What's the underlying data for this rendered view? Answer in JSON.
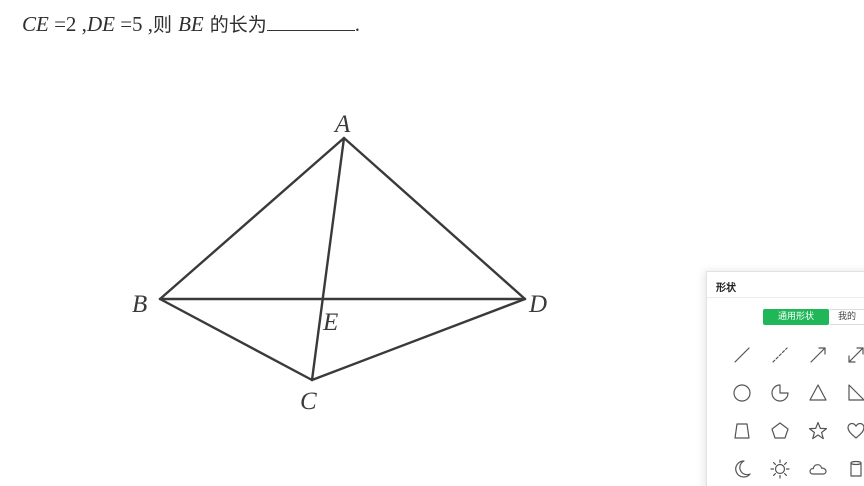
{
  "question": {
    "seg1": "CE",
    "seg2": " =2 ,",
    "seg3": "DE",
    "seg4": " =5 ,",
    "seg5": "则 ",
    "seg6": "BE",
    "seg7": " 的长为",
    "seg8": "."
  },
  "figure": {
    "labels": {
      "A": "A",
      "B": "B",
      "C": "C",
      "D": "D",
      "E": "E"
    },
    "colors": {
      "line": "#3a3a3a"
    }
  },
  "shape_panel": {
    "title": "形状",
    "tabs": [
      {
        "label": "通用形状",
        "active": true
      },
      {
        "label": "我的",
        "active": false
      }
    ],
    "shapes": [
      "line-icon",
      "dashed-line-icon",
      "arrow-icon",
      "double-arrow-icon",
      "circle-icon",
      "pie-icon",
      "triangle-icon",
      "right-triangle-icon",
      "trapezoid-icon",
      "pentagon-icon",
      "star-icon",
      "heart-icon",
      "moon-icon",
      "sun-icon",
      "cloud-icon",
      "cylinder-icon"
    ],
    "colors": {
      "accent": "#20b759"
    }
  }
}
